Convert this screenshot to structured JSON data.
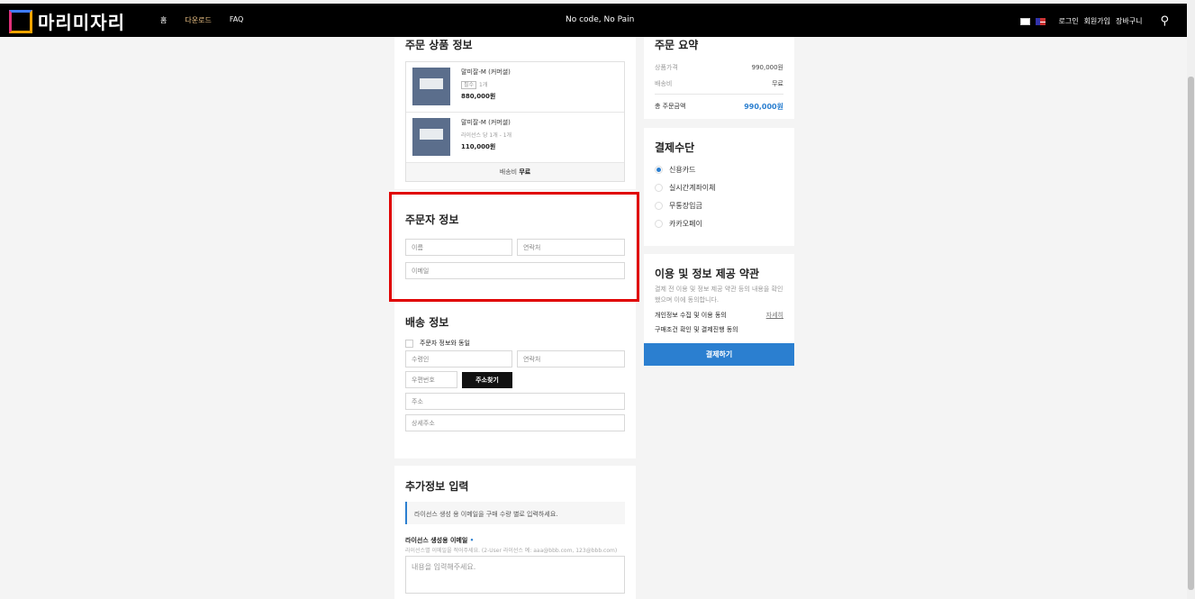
{
  "header": {
    "logo": "마리미자리",
    "nav": [
      "홈",
      "다운로드",
      "FAQ"
    ],
    "slogan": "No code, No Pain",
    "links": [
      "로그인",
      "회원가입",
      "장바구니"
    ]
  },
  "products": {
    "title": "주문 상품 정보",
    "items": [
      {
        "name": "말미잘-M (커머셜)",
        "required": "필수",
        "qty": "1개",
        "price": "880,000원"
      },
      {
        "name": "말미잘-M (커머셜)",
        "option": "라이선스 당 1개 - 1개",
        "price": "110,000원"
      }
    ],
    "shipping_label": "배송비",
    "shipping_value": "무료"
  },
  "orderer": {
    "title": "주문자 정보",
    "name_ph": "이름",
    "phone_ph": "연락처",
    "email_ph": "이메일"
  },
  "delivery": {
    "title": "배송 정보",
    "same_label": "주문자 정보와 동일",
    "recipient_ph": "수령인",
    "phone_ph": "연락처",
    "zip_ph": "우편번호",
    "find_address": "주소찾기",
    "address_ph": "주소",
    "detail_ph": "상세주소"
  },
  "extra": {
    "title": "추가정보 입력",
    "notice": "라이선스 생성 용 이메일을 구매 수량 별로 입력하세요.",
    "field_label": "라이선스 생성용 이메일",
    "help": "라이선스별 이메일을 적어주세요. (2-User 라이선스 예: aaa@bbb.com, 123@bbb.com)",
    "placeholder": "내용을 입력해주세요."
  },
  "summary": {
    "title": "주문 요약",
    "price_label": "상품가격",
    "price": "990,000원",
    "ship_label": "배송비",
    "ship": "무료",
    "total_label": "총 주문금액",
    "total": "990,000원"
  },
  "payment": {
    "title": "결제수단",
    "options": [
      "신용카드",
      "실시간계좌이체",
      "무통장입금",
      "카카오페이"
    ],
    "selected": 0
  },
  "terms": {
    "title": "이용 및 정보 제공 약관",
    "desc": "결제 전 이용 및 정보 제공 약관 등의 내용을 확인 했으며 이에 동의합니다.",
    "item1": "개인정보 수집 및 이용 동의",
    "detail": "자세히",
    "item2": "구매조건 확인 및 결제진행 동의",
    "pay_button": "결제하기"
  },
  "colors": {
    "accent": "#2b7fd0",
    "highlight": "#e00000"
  }
}
